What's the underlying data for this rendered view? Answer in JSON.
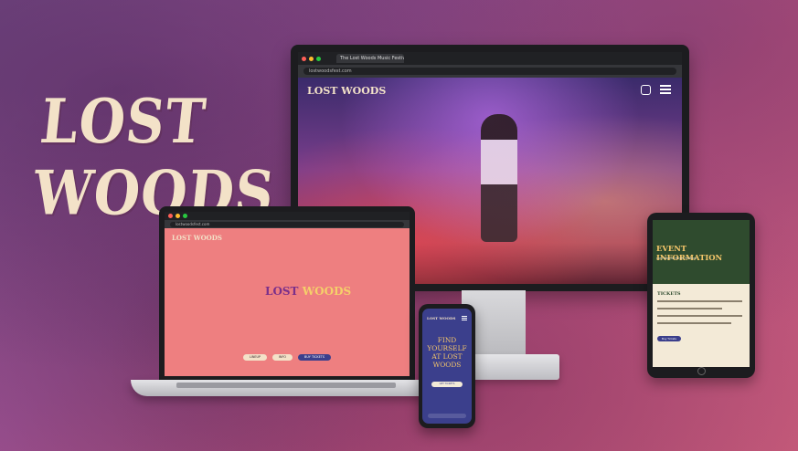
{
  "brand": {
    "logo_text": "LOST WOODS"
  },
  "desktop": {
    "tab_title": "The Lost Woods Music Festival",
    "url": "lostwoodsfest.com",
    "site_logo": "LOST WOODS",
    "icons": [
      "instagram-icon",
      "menu-icon"
    ]
  },
  "laptop": {
    "url": "lostwoodsfest.com",
    "site_logo": "LOST WOODS",
    "center_logo_a": "LOST",
    "center_logo_b": "WOODS",
    "buttons": [
      "LINEUP",
      "INFO",
      "BUY TICKETS"
    ]
  },
  "tablet": {
    "title": "EVENT INFORMATION",
    "subtitle": "Lost Woods Music Festival",
    "tickets_heading": "TICKETS",
    "cta": "Buy Tickets"
  },
  "phone": {
    "site_logo": "LOST WOODS",
    "headline": "FIND YOURSELF AT LOST WOODS",
    "cta": "GET TICKETS"
  },
  "colors": {
    "cream": "#f3e2c8",
    "forest": "#2f4b2e",
    "indigo": "#3b3f8c",
    "coral": "#ee7f80",
    "gold": "#f5c66a"
  }
}
